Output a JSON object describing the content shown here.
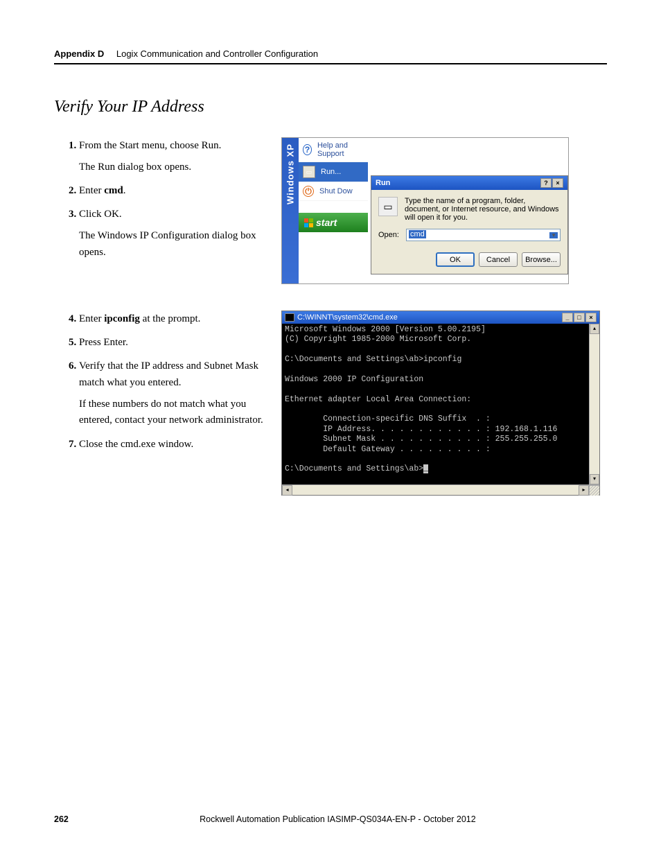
{
  "header": {
    "appendix": "Appendix D",
    "chapter": "Logix Communication and Controller Configuration"
  },
  "section_title": "Verify Your IP Address",
  "block1": {
    "steps": [
      {
        "num": "1",
        "text_a": "From the Start menu, choose Run.",
        "text_b": "The Run dialog box opens."
      },
      {
        "num": "2",
        "text_a": "Enter ",
        "bold": "cmd",
        "text_c": "."
      },
      {
        "num": "3",
        "text_a": "Click OK.",
        "text_b": "The Windows IP Configuration dialog box opens."
      }
    ]
  },
  "block2": {
    "steps": [
      {
        "num": "4",
        "text_a": "Enter ",
        "bold": "ipconfig",
        "text_c": " at the prompt."
      },
      {
        "num": "5",
        "text_a": "Press Enter."
      },
      {
        "num": "6",
        "text_a": "Verify that the IP address and Subnet Mask match what you entered.",
        "text_b": "If these numbers do not match what you entered, contact your network administrator."
      },
      {
        "num": "7",
        "text_a": "Close the cmd.exe window."
      }
    ]
  },
  "start_menu": {
    "sidebar_label": "Windows XP",
    "items": {
      "help": "Help and Support",
      "run": "Run...",
      "shutdown": "Shut Dow"
    },
    "start_label": "start"
  },
  "run_dialog": {
    "title": "Run",
    "description": "Type the name of a program, folder, document, or Internet resource, and Windows will open it for you.",
    "open_label": "Open:",
    "input_value": "cmd",
    "buttons": {
      "ok": "OK",
      "cancel": "Cancel",
      "browse": "Browse..."
    }
  },
  "cmd_window": {
    "title": "C:\\WINNT\\system32\\cmd.exe",
    "lines": {
      "l1": "Microsoft Windows 2000 [Version 5.00.2195]",
      "l2": "(C) Copyright 1985-2000 Microsoft Corp.",
      "l3": "",
      "l4": "C:\\Documents and Settings\\ab>ipconfig",
      "l5": "",
      "l6": "Windows 2000 IP Configuration",
      "l7": "",
      "l8": "Ethernet adapter Local Area Connection:",
      "l9": "",
      "l10": "        Connection-specific DNS Suffix  . :",
      "l11": "        IP Address. . . . . . . . . . . . : 192.168.1.116",
      "l12": "        Subnet Mask . . . . . . . . . . . : 255.255.255.0",
      "l13": "        Default Gateway . . . . . . . . . :",
      "l14": "",
      "l15_a": "C:\\Documents and Settings\\ab>",
      "l15_b": "_"
    }
  },
  "footer": {
    "page": "262",
    "pub_a": "Rockwell Automation Publication IASIMP-QS034A-EN-P - ",
    "pub_b": "October 2012"
  }
}
